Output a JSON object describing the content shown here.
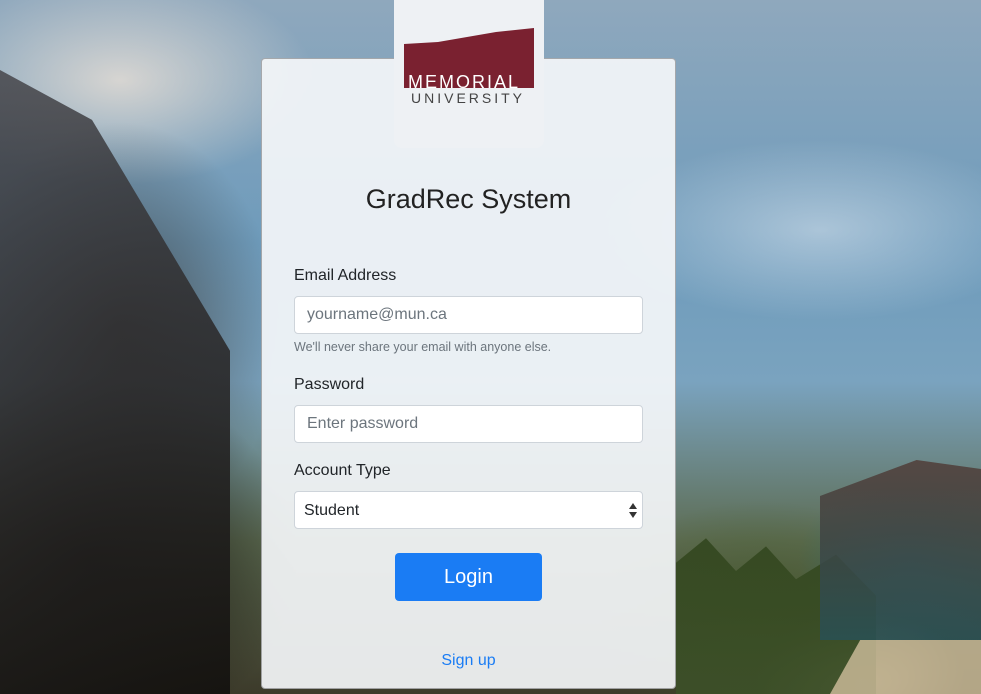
{
  "logo": {
    "line1": "MEMORIAL",
    "line2": "UNIVERSITY",
    "brand_color": "#7a2130"
  },
  "title": "GradRec System",
  "email": {
    "label": "Email Address",
    "placeholder": "yourname@mun.ca",
    "value": "",
    "help": "We'll never share your email with anyone else."
  },
  "password": {
    "label": "Password",
    "placeholder": "Enter password",
    "value": ""
  },
  "account_type": {
    "label": "Account Type",
    "selected": "Student"
  },
  "actions": {
    "login_label": "Login",
    "signup_label": "Sign up"
  },
  "colors": {
    "primary": "#1a7cf4",
    "card_bg": "#f4f6f9"
  }
}
